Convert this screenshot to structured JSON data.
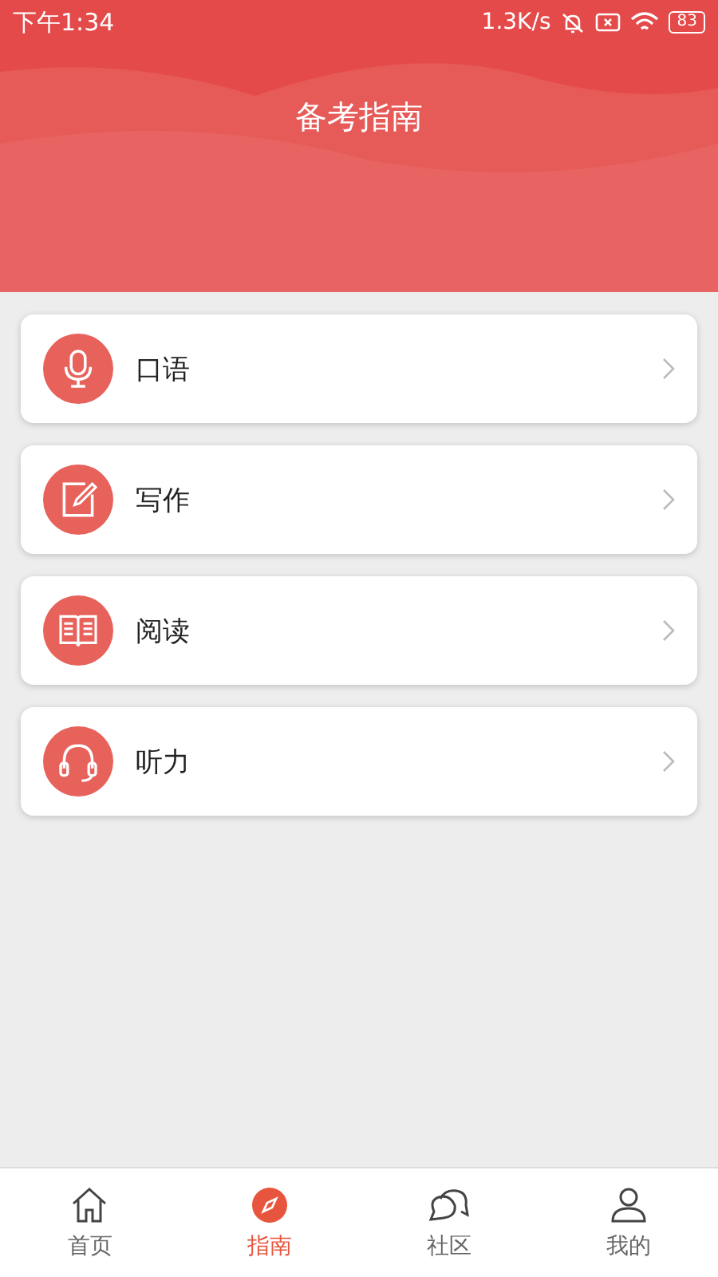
{
  "status_bar": {
    "time": "下午1:34",
    "speed": "1.3K/s",
    "battery": "83"
  },
  "header": {
    "title": "备考指南"
  },
  "items": [
    {
      "label": "口语",
      "kind": "mic"
    },
    {
      "label": "写作",
      "kind": "edit"
    },
    {
      "label": "阅读",
      "kind": "book"
    },
    {
      "label": "听力",
      "kind": "headset"
    }
  ],
  "tabs": [
    {
      "label": "首页",
      "kind": "home",
      "selected": false
    },
    {
      "label": "指南",
      "kind": "compass",
      "selected": true
    },
    {
      "label": "社区",
      "kind": "chat",
      "selected": false
    },
    {
      "label": "我的",
      "kind": "user",
      "selected": false
    }
  ]
}
